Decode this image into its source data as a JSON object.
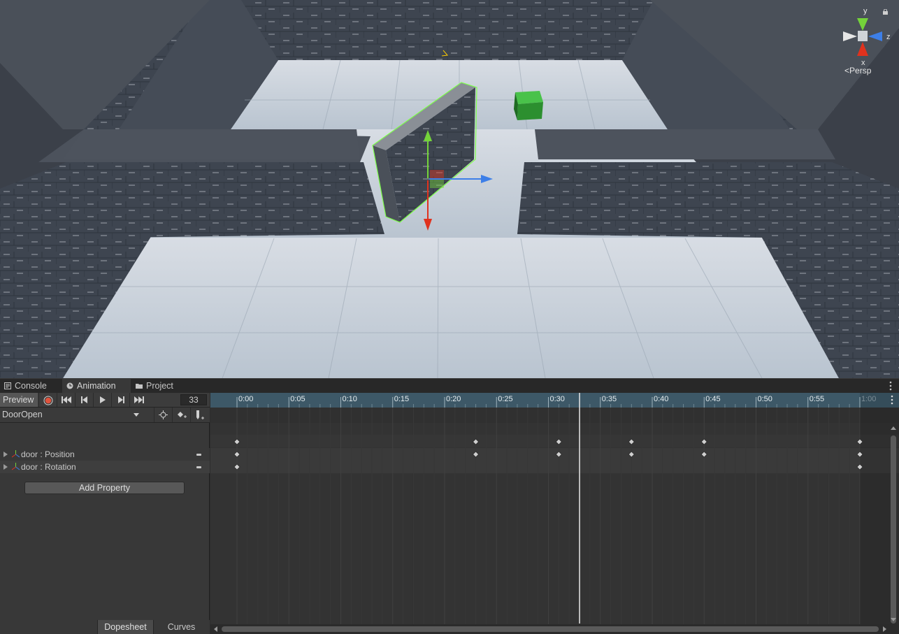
{
  "scene_view": {
    "gizmo": {
      "axis_y": "y",
      "axis_x": "x",
      "axis_z": "z",
      "projection": "Persp"
    },
    "selected_object": "door",
    "colors": {
      "wall": "#3f4650",
      "floor": "#c9d2dc",
      "selection_outline": "#7dff4a",
      "cube": "#2c8f2f",
      "gizmo_y": "#74d33a",
      "gizmo_x": "#e0321e",
      "gizmo_z": "#3d7fe8"
    }
  },
  "panel": {
    "tabs": [
      {
        "label": "Console",
        "icon": "console-icon"
      },
      {
        "label": "Animation",
        "icon": "clock-icon"
      },
      {
        "label": "Project",
        "icon": "folder-icon"
      }
    ],
    "active_tab": "Animation",
    "toolbar": {
      "preview_label": "Preview",
      "record": "record-icon",
      "buttons": [
        "first-key-icon",
        "prev-key-icon",
        "play-icon",
        "next-key-icon",
        "last-key-icon"
      ],
      "current_frame": "33"
    },
    "clip": {
      "name": "DoorOpen"
    },
    "properties": [
      {
        "label": "door : Position"
      },
      {
        "label": "door : Rotation"
      }
    ],
    "add_property_label": "Add Property",
    "modes": {
      "dopesheet": "Dopesheet",
      "curves": "Curves",
      "active": "Dopesheet"
    },
    "ruler": {
      "labels": [
        "0:00",
        "0:05",
        "0:10",
        "0:15",
        "0:20",
        "0:25",
        "0:30",
        "0:35",
        "0:40",
        "0:45",
        "0:50",
        "0:55",
        "1:00"
      ],
      "end_frame_label": "1:00"
    },
    "playhead_frame": 33,
    "keyframes": {
      "summary": [
        0,
        23,
        31,
        38,
        45,
        60
      ],
      "position": [
        0,
        23,
        31,
        38,
        45,
        60
      ],
      "rotation": [
        0,
        60
      ]
    },
    "frame_rate": 60
  }
}
